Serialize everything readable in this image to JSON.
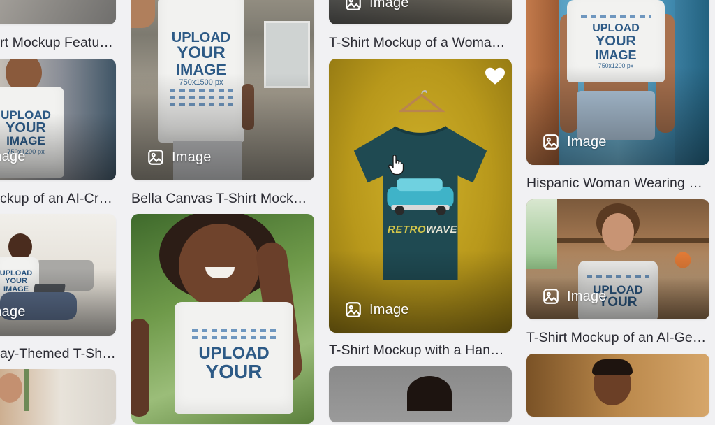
{
  "badge_label": "Image",
  "captions": {
    "c0_r1": "rt Mockup Featu…",
    "c0_r2": "ckup of an AI-Cre…",
    "c0_r3": "ay-Themed T-Shi…",
    "c1_r1": "Bella Canvas T-Shirt Mocku…",
    "c2_r0": "T-Shirt Mockup of a Woma…",
    "c2_r1": "T-Shirt Mockup with a Han…",
    "c3_r1": "Hispanic Woman Wearing …",
    "c3_r2": "T-Shirt Mockup of an AI-Ge…"
  },
  "shirt_prints": {
    "upload": "UPLOAD",
    "your": "YOUR",
    "image": "IMAGE",
    "size_750x1500": "750x1500 px",
    "size_750x1200": "750x1200 px",
    "retro": "RETRO",
    "wave": "WAVE"
  },
  "colors": {
    "page_bg": "#f1f1f3",
    "mustard_bg": "#c3a21c",
    "teal_shirt": "#1f4a52",
    "print_blue": "#2d5a86"
  },
  "icons": [
    "image-icon",
    "heart-icon",
    "hand-pointer-icon"
  ]
}
